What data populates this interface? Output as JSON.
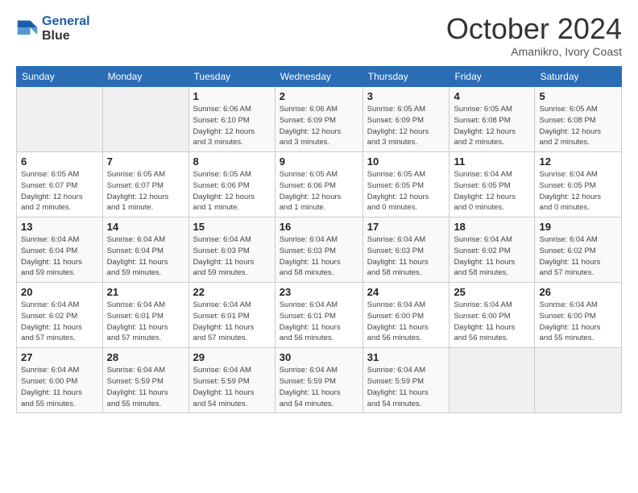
{
  "logo": {
    "line1": "General",
    "line2": "Blue"
  },
  "header": {
    "month": "October 2024",
    "location": "Amanikro, Ivory Coast"
  },
  "weekdays": [
    "Sunday",
    "Monday",
    "Tuesday",
    "Wednesday",
    "Thursday",
    "Friday",
    "Saturday"
  ],
  "weeks": [
    [
      {
        "day": "",
        "info": ""
      },
      {
        "day": "",
        "info": ""
      },
      {
        "day": "1",
        "info": "Sunrise: 6:06 AM\nSunset: 6:10 PM\nDaylight: 12 hours\nand 3 minutes."
      },
      {
        "day": "2",
        "info": "Sunrise: 6:06 AM\nSunset: 6:09 PM\nDaylight: 12 hours\nand 3 minutes."
      },
      {
        "day": "3",
        "info": "Sunrise: 6:05 AM\nSunset: 6:09 PM\nDaylight: 12 hours\nand 3 minutes."
      },
      {
        "day": "4",
        "info": "Sunrise: 6:05 AM\nSunset: 6:08 PM\nDaylight: 12 hours\nand 2 minutes."
      },
      {
        "day": "5",
        "info": "Sunrise: 6:05 AM\nSunset: 6:08 PM\nDaylight: 12 hours\nand 2 minutes."
      }
    ],
    [
      {
        "day": "6",
        "info": "Sunrise: 6:05 AM\nSunset: 6:07 PM\nDaylight: 12 hours\nand 2 minutes."
      },
      {
        "day": "7",
        "info": "Sunrise: 6:05 AM\nSunset: 6:07 PM\nDaylight: 12 hours\nand 1 minute."
      },
      {
        "day": "8",
        "info": "Sunrise: 6:05 AM\nSunset: 6:06 PM\nDaylight: 12 hours\nand 1 minute."
      },
      {
        "day": "9",
        "info": "Sunrise: 6:05 AM\nSunset: 6:06 PM\nDaylight: 12 hours\nand 1 minute."
      },
      {
        "day": "10",
        "info": "Sunrise: 6:05 AM\nSunset: 6:05 PM\nDaylight: 12 hours\nand 0 minutes."
      },
      {
        "day": "11",
        "info": "Sunrise: 6:04 AM\nSunset: 6:05 PM\nDaylight: 12 hours\nand 0 minutes."
      },
      {
        "day": "12",
        "info": "Sunrise: 6:04 AM\nSunset: 6:05 PM\nDaylight: 12 hours\nand 0 minutes."
      }
    ],
    [
      {
        "day": "13",
        "info": "Sunrise: 6:04 AM\nSunset: 6:04 PM\nDaylight: 11 hours\nand 59 minutes."
      },
      {
        "day": "14",
        "info": "Sunrise: 6:04 AM\nSunset: 6:04 PM\nDaylight: 11 hours\nand 59 minutes."
      },
      {
        "day": "15",
        "info": "Sunrise: 6:04 AM\nSunset: 6:03 PM\nDaylight: 11 hours\nand 59 minutes."
      },
      {
        "day": "16",
        "info": "Sunrise: 6:04 AM\nSunset: 6:03 PM\nDaylight: 11 hours\nand 58 minutes."
      },
      {
        "day": "17",
        "info": "Sunrise: 6:04 AM\nSunset: 6:03 PM\nDaylight: 11 hours\nand 58 minutes."
      },
      {
        "day": "18",
        "info": "Sunrise: 6:04 AM\nSunset: 6:02 PM\nDaylight: 11 hours\nand 58 minutes."
      },
      {
        "day": "19",
        "info": "Sunrise: 6:04 AM\nSunset: 6:02 PM\nDaylight: 11 hours\nand 57 minutes."
      }
    ],
    [
      {
        "day": "20",
        "info": "Sunrise: 6:04 AM\nSunset: 6:02 PM\nDaylight: 11 hours\nand 57 minutes."
      },
      {
        "day": "21",
        "info": "Sunrise: 6:04 AM\nSunset: 6:01 PM\nDaylight: 11 hours\nand 57 minutes."
      },
      {
        "day": "22",
        "info": "Sunrise: 6:04 AM\nSunset: 6:01 PM\nDaylight: 11 hours\nand 57 minutes."
      },
      {
        "day": "23",
        "info": "Sunrise: 6:04 AM\nSunset: 6:01 PM\nDaylight: 11 hours\nand 56 minutes."
      },
      {
        "day": "24",
        "info": "Sunrise: 6:04 AM\nSunset: 6:00 PM\nDaylight: 11 hours\nand 56 minutes."
      },
      {
        "day": "25",
        "info": "Sunrise: 6:04 AM\nSunset: 6:00 PM\nDaylight: 11 hours\nand 56 minutes."
      },
      {
        "day": "26",
        "info": "Sunrise: 6:04 AM\nSunset: 6:00 PM\nDaylight: 11 hours\nand 55 minutes."
      }
    ],
    [
      {
        "day": "27",
        "info": "Sunrise: 6:04 AM\nSunset: 6:00 PM\nDaylight: 11 hours\nand 55 minutes."
      },
      {
        "day": "28",
        "info": "Sunrise: 6:04 AM\nSunset: 5:59 PM\nDaylight: 11 hours\nand 55 minutes."
      },
      {
        "day": "29",
        "info": "Sunrise: 6:04 AM\nSunset: 5:59 PM\nDaylight: 11 hours\nand 54 minutes."
      },
      {
        "day": "30",
        "info": "Sunrise: 6:04 AM\nSunset: 5:59 PM\nDaylight: 11 hours\nand 54 minutes."
      },
      {
        "day": "31",
        "info": "Sunrise: 6:04 AM\nSunset: 5:59 PM\nDaylight: 11 hours\nand 54 minutes."
      },
      {
        "day": "",
        "info": ""
      },
      {
        "day": "",
        "info": ""
      }
    ]
  ]
}
